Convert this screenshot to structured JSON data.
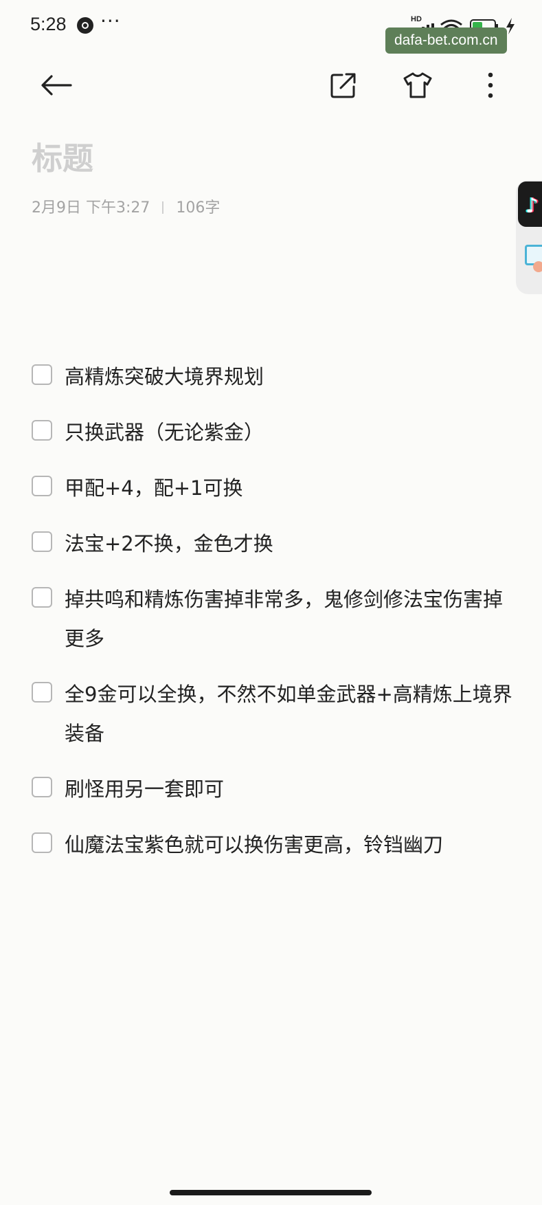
{
  "status_bar": {
    "time": "5:28",
    "more_glyph": "···",
    "network_badge": "HD",
    "battery_level": "33",
    "icons": [
      "clock-icon",
      "signal-icon",
      "wifi-icon",
      "battery-icon",
      "charging-icon"
    ]
  },
  "watermark": "dafa-bet.com.cn",
  "toolbar": {
    "icons": [
      "back-arrow-icon",
      "share-icon",
      "shirt-theme-icon",
      "more-vertical-icon"
    ]
  },
  "note": {
    "title_placeholder": "标题",
    "date": "2月9日 下午3:27",
    "word_count": "106字"
  },
  "side_widget": {
    "icons": [
      "tiktok-icon",
      "app-icon"
    ]
  },
  "checklist": [
    {
      "text": "高精炼突破大境界规划",
      "checked": false
    },
    {
      "text": "只换武器（无论紫金）",
      "checked": false
    },
    {
      "text": "甲配+4，配+1可换",
      "checked": false
    },
    {
      "text": "法宝+2不换，金色才换",
      "checked": false
    },
    {
      "text": "掉共鸣和精炼伤害掉非常多，鬼修剑修法宝伤害掉更多",
      "checked": false
    },
    {
      "text": "全9金可以全换，不然不如单金武器+高精炼上境界装备",
      "checked": false
    },
    {
      "text": "刷怪用另一套即可",
      "checked": false
    },
    {
      "text": "仙魔法宝紫色就可以换伤害更高，铃铛幽刀",
      "checked": false
    }
  ],
  "colors": {
    "background": "#fbfbf9",
    "text": "#222222",
    "placeholder": "#cfcfcf",
    "meta": "#a3a3a3",
    "checkbox_border": "#b6b6b6",
    "watermark_bg": "#5e7f58"
  }
}
